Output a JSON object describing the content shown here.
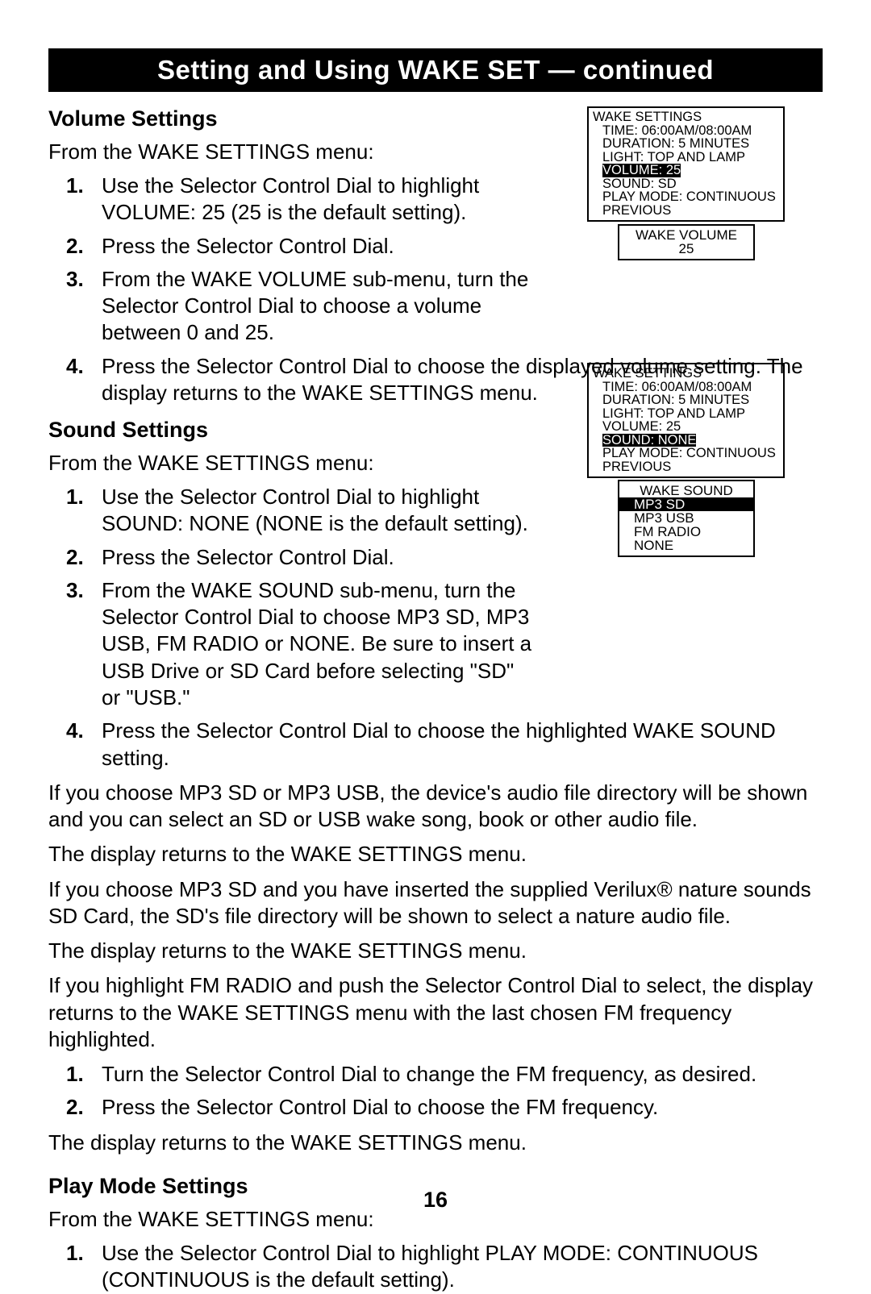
{
  "title": "Setting and Using WAKE SET — continued",
  "page_number": "16",
  "sections": {
    "volume": {
      "heading": "Volume Settings",
      "intro": "From the WAKE SETTINGS menu:",
      "steps": [
        "Use the Selector Control Dial to highlight VOLUME: 25 (25 is the default setting).",
        "Press the Selector Control Dial.",
        "From the WAKE VOLUME sub-menu, turn the Selector Control Dial to choose a volume between 0 and 25.",
        "Press the Selector Control Dial to choose the displayed volume setting. The display returns to the WAKE SETTINGS menu."
      ]
    },
    "sound": {
      "heading": "Sound Settings",
      "intro": "From the WAKE SETTINGS menu:",
      "steps": [
        "Use the Selector Control Dial to highlight SOUND: NONE (NONE is the default setting).",
        "Press the Selector Control Dial.",
        "From the WAKE SOUND sub-menu, turn the Selector Control Dial to choose MP3 SD, MP3 USB, FM RADIO or NONE. Be sure to insert a USB Drive or SD Card before selecting \"SD\" or \"USB.\"",
        "Press the Selector Control Dial to choose the highlighted WAKE SOUND setting."
      ],
      "paras": [
        "If you choose MP3 SD or MP3 USB, the device's audio file directory will be shown and you can select an SD or USB wake song, book or other audio file.",
        "The display returns to the WAKE SETTINGS menu.",
        "If you choose MP3 SD and you have inserted the supplied Verilux® nature sounds SD Card, the SD's file directory will be shown to select a nature audio file.",
        "The display returns to the WAKE SETTINGS menu.",
        "If you highlight FM RADIO and push the Selector Control Dial to select, the display returns to the WAKE SETTINGS menu with the last chosen FM frequency highlighted."
      ],
      "fm_steps": [
        "Turn the Selector Control Dial to change the FM frequency, as desired.",
        "Press the Selector Control Dial to choose the FM frequency."
      ],
      "after_fm": "The display returns to the WAKE SETTINGS menu."
    },
    "playmode": {
      "heading": "Play Mode Settings",
      "intro": "From the WAKE SETTINGS menu:",
      "steps": [
        "Use the Selector Control Dial to highlight PLAY MODE: CONTINUOUS (CONTINUOUS is the default setting)."
      ]
    }
  },
  "lcd_volume_settings": {
    "title": "WAKE SETTINGS",
    "lines": {
      "time": "TIME: 06:00AM/08:00AM",
      "duration": "DURATION: 5 MINUTES",
      "light": "LIGHT: TOP AND LAMP",
      "volume": "VOLUME: 25",
      "sound": "SOUND: SD",
      "playmode": "PLAY MODE: CONTINUOUS",
      "previous": "PREVIOUS"
    }
  },
  "lcd_wake_volume": {
    "title": "WAKE VOLUME",
    "value": "25"
  },
  "lcd_sound_settings": {
    "title": "WAKE SETTINGS",
    "lines": {
      "time": "TIME: 06:00AM/08:00AM",
      "duration": "DURATION: 5 MINUTES",
      "light": "LIGHT: TOP AND LAMP",
      "volume": "VOLUME: 25",
      "sound": "SOUND: NONE",
      "playmode": "PLAY MODE: CONTINUOUS",
      "previous": "PREVIOUS"
    }
  },
  "lcd_wake_sound": {
    "title": "WAKE SOUND",
    "options": [
      "MP3 SD",
      "MP3 USB",
      "FM RADIO",
      "NONE"
    ],
    "selected_index": 0
  }
}
